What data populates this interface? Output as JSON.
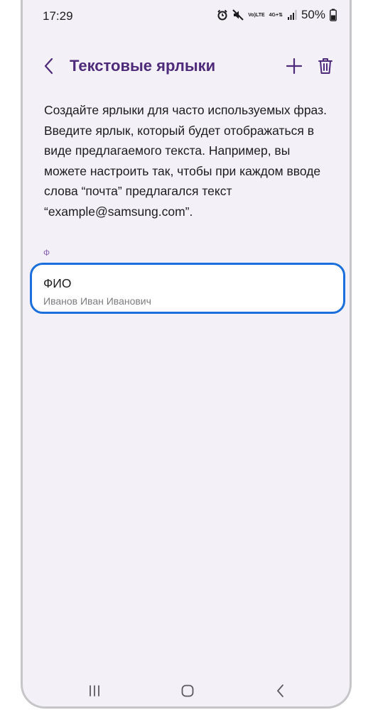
{
  "status_bar": {
    "time": "17:29",
    "net_top": "Vo)",
    "net_bottom": "LTE",
    "network_gen": "4G+",
    "battery_percent": "50%"
  },
  "header": {
    "title": "Текстовые ярлыки"
  },
  "description": "Создайте ярлыки для часто используемых фраз. Введите ярлык, который будет отображаться в виде предлагаемого текста. Например, вы можете настроить так, чтобы при каждом вводе слова “почта” предлагался текст “example@samsung.com”.",
  "section": {
    "letter": "Ф"
  },
  "shortcuts": [
    {
      "name": "ФИО",
      "phrase": "Иванов Иван Иванович"
    }
  ],
  "colors": {
    "background": "#f3f1f7",
    "title": "#4e2a7a",
    "accent": "#8a62b8",
    "selection_border": "#1b6fdc"
  },
  "icons": {
    "back": "chevron-left-icon",
    "add": "plus-icon",
    "delete": "trash-icon",
    "alarm": "alarm-icon",
    "mute": "mute-icon",
    "signal": "signal-icon",
    "battery": "battery-icon",
    "nav_recent": "recent-apps-icon",
    "nav_home": "home-icon",
    "nav_back": "nav-back-icon"
  }
}
